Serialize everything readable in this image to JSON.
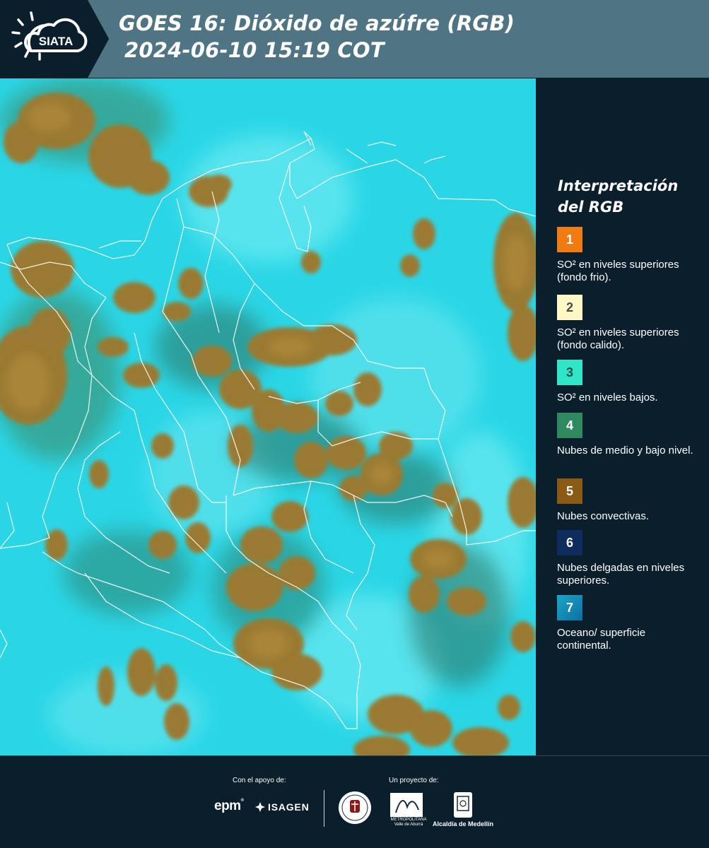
{
  "header": {
    "title_line_1": "GOES 16: Dióxido de azúfre (RGB)",
    "title_line_2": "2024-06-10 15:19 COT",
    "logo_text": "SIATA"
  },
  "map": {
    "type": "satellite-rgb-composite",
    "colors": {
      "background": "#2ad6e6",
      "clear_light": "#6ee7f0",
      "convective": "#9a7a32",
      "mid_low": "#3c8c6a",
      "borders": "#ffffff"
    }
  },
  "legend": {
    "title": "Interpretación del RGB",
    "items": [
      {
        "number": "1",
        "color": "#f07b10",
        "text_color": "#ffffff",
        "label": "SO² en niveles superiores (fondo frio)."
      },
      {
        "number": "2",
        "color": "#fff7c6",
        "text_color": "#4a4a4a",
        "label": "SO² en niveles superiores (fondo calido)."
      },
      {
        "number": "3",
        "color": "#2fe6c8",
        "text_color": "#2a4a4a",
        "label": "SO² en niveles bajos."
      },
      {
        "number": "4",
        "color": "#2e8a5e",
        "text_color": "#ffffff",
        "label": "Nubes de medio y bajo nivel."
      },
      {
        "number": "5",
        "color": "#8a5a14",
        "text_color": "#ffffff",
        "label": "Nubes convectivas."
      },
      {
        "number": "6",
        "color": "#0e2c5c",
        "text_color": "#ffffff",
        "label": "Nubes delgadas en niveles superiores."
      },
      {
        "number": "7",
        "color": "#1a8cb8",
        "text_color": "#ffffff",
        "label": "Oceano/ superficie continental."
      }
    ]
  },
  "footer": {
    "support_label": "Con el apoyo de:",
    "project_label": "Un proyecto de:",
    "epm_logo": "epm",
    "isagen_logo": "ISAGEN",
    "area_logo_lines": [
      "METROPOLITANA",
      "Valle de Aburrá"
    ],
    "alcaldia_logo": "Alcaldía de Medellín"
  }
}
